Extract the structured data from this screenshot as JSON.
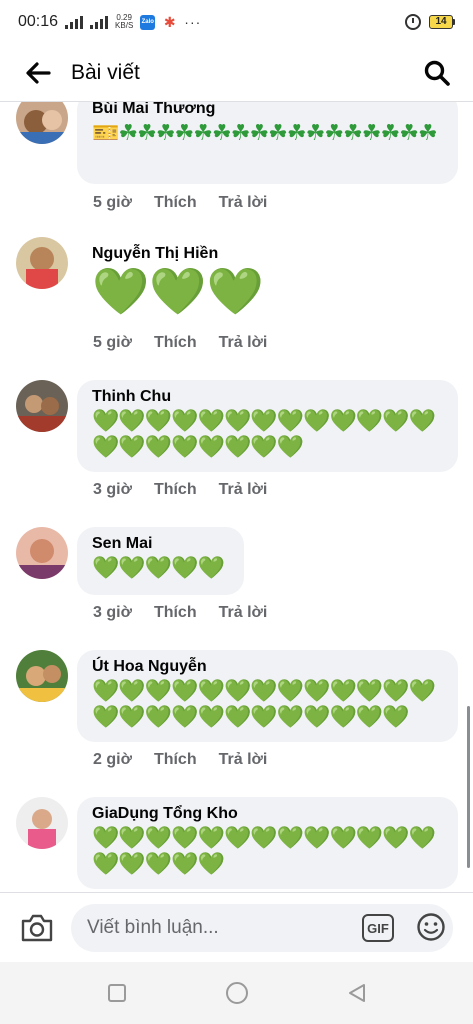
{
  "status_bar": {
    "time": "00:16",
    "net_speed_value": "0.29",
    "net_speed_unit": "KB/S",
    "zalo_label": "Zalo",
    "more_dots": "···",
    "battery": "14"
  },
  "header": {
    "title": "Bài viết"
  },
  "comments": [
    {
      "name": "Bùi Mai Thương",
      "text": "🎫☘☘☘☘☘☘☘☘☘☘☘☘☘☘☘☘☘",
      "time": "5 giờ",
      "like": "Thích",
      "reply": "Trả lời"
    },
    {
      "name": "Nguyễn Thị Hiền",
      "text": "💚💚💚",
      "time": "5 giờ",
      "like": "Thích",
      "reply": "Trả lời"
    },
    {
      "name": "Thinh Chu",
      "text": "💚💚💚💚💚💚💚💚💚💚💚💚💚💚💚💚💚💚💚💚💚",
      "time": "3 giờ",
      "like": "Thích",
      "reply": "Trả lời"
    },
    {
      "name": "Sen Mai",
      "text": "💚💚💚💚💚",
      "time": "3 giờ",
      "like": "Thích",
      "reply": "Trả lời"
    },
    {
      "name": "Út Hoa Nguyễn",
      "text": "💚💚💚💚💚💚💚💚💚💚💚💚💚💚💚💚💚💚💚💚💚💚💚💚💚",
      "time": "2 giờ",
      "like": "Thích",
      "reply": "Trả lời"
    },
    {
      "name": "GiaDụng Tổng Kho",
      "text": "💚💚💚💚💚💚💚💚💚💚💚💚💚💚💚💚💚💚",
      "time": "",
      "like": "",
      "reply": ""
    }
  ],
  "composer": {
    "placeholder": "Viết bình luận...",
    "gif_label": "GIF"
  },
  "colors": {
    "heart_green": "#2ecc40",
    "bubble_bg": "#f0f2f5",
    "meta_gray": "#65676b"
  }
}
